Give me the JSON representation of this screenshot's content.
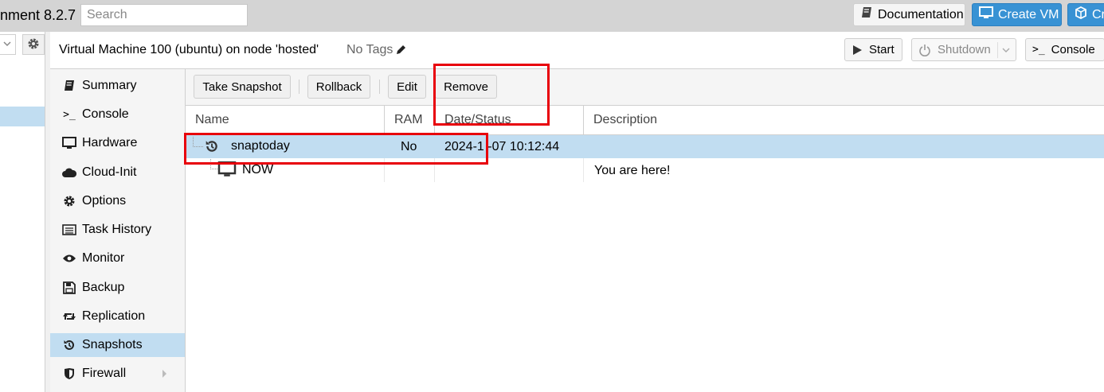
{
  "topbar": {
    "brand_text": "nment 8.2.7",
    "search_placeholder": "Search",
    "documentation_label": "Documentation",
    "create_vm_label": "Create VM",
    "create_ct_label": "Cr"
  },
  "vm_header": {
    "title": "Virtual Machine 100 (ubuntu) on node 'hosted'",
    "tags_label": "No Tags",
    "start_label": "Start",
    "shutdown_label": "Shutdown",
    "console_label": "Console"
  },
  "nav": {
    "items": [
      {
        "label": "Summary",
        "icon": "book-icon"
      },
      {
        "label": "Console",
        "icon": "terminal-icon"
      },
      {
        "label": "Hardware",
        "icon": "desktop-icon"
      },
      {
        "label": "Cloud-Init",
        "icon": "cloud-icon"
      },
      {
        "label": "Options",
        "icon": "gear-icon"
      },
      {
        "label": "Task History",
        "icon": "list-icon"
      },
      {
        "label": "Monitor",
        "icon": "eye-icon"
      },
      {
        "label": "Backup",
        "icon": "floppy-icon"
      },
      {
        "label": "Replication",
        "icon": "retweet-icon"
      },
      {
        "label": "Snapshots",
        "icon": "history-icon"
      },
      {
        "label": "Firewall",
        "icon": "shield-icon"
      }
    ],
    "selected": "Snapshots"
  },
  "toolbar": {
    "take_snapshot_label": "Take Snapshot",
    "rollback_label": "Rollback",
    "edit_label": "Edit",
    "remove_label": "Remove"
  },
  "grid": {
    "columns": [
      "Name",
      "RAM",
      "Date/Status",
      "Description"
    ],
    "rows": [
      {
        "name": "snaptoday",
        "ram": "No",
        "date": "2024-1 -07 10:12:44",
        "description": "",
        "icon": "history-icon"
      },
      {
        "name": "NOW",
        "ram": "",
        "date": "",
        "description": "You are here!",
        "icon": "desktop-icon"
      }
    ]
  },
  "colors": {
    "accent": "#3892d4",
    "selection": "#c1ddf1",
    "highlight_red": "#e8000b"
  }
}
